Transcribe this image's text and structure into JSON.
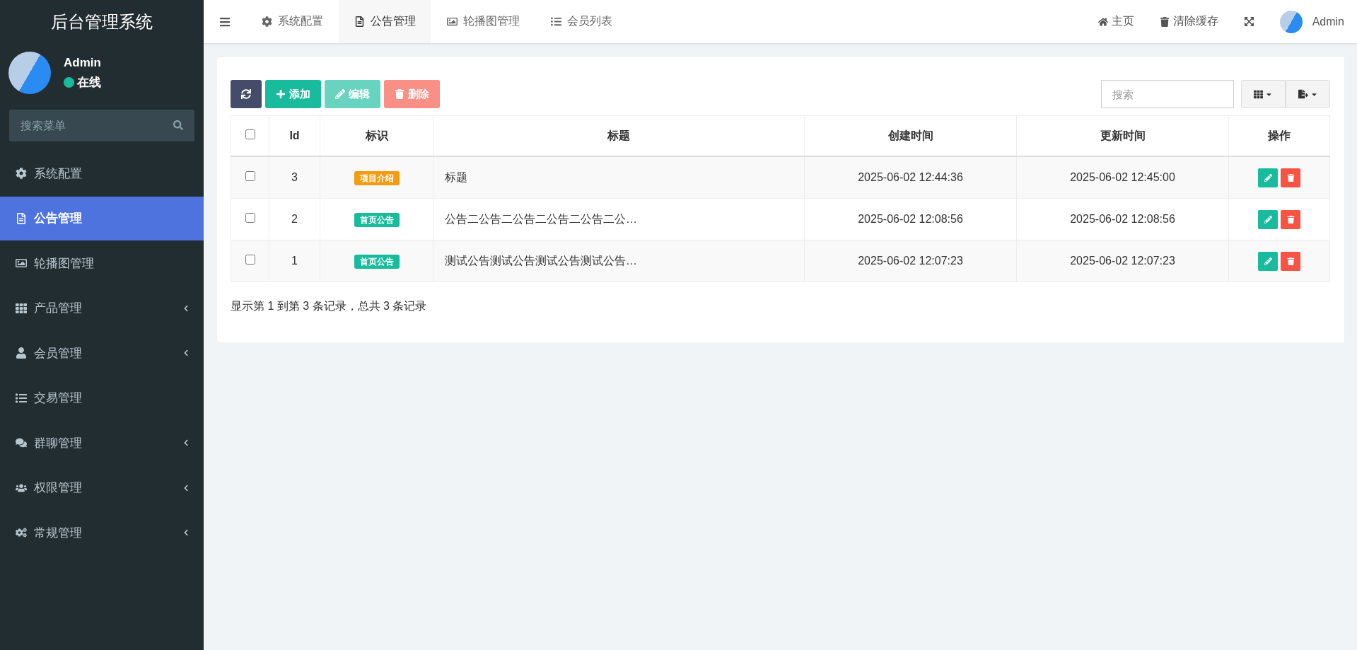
{
  "sidebar": {
    "title": "后台管理系统",
    "user": {
      "name": "Admin",
      "status": "在线"
    },
    "search": {
      "placeholder": "搜索菜单"
    },
    "items": [
      {
        "label": "系统配置",
        "selected": false,
        "expandable": false
      },
      {
        "label": "公告管理",
        "selected": true,
        "expandable": false
      },
      {
        "label": "轮播图管理",
        "selected": false,
        "expandable": false
      },
      {
        "label": "产品管理",
        "selected": false,
        "expandable": true
      },
      {
        "label": "会员管理",
        "selected": false,
        "expandable": true
      },
      {
        "label": "交易管理",
        "selected": false,
        "expandable": false
      },
      {
        "label": "群聊管理",
        "selected": false,
        "expandable": true
      },
      {
        "label": "权限管理",
        "selected": false,
        "expandable": true
      },
      {
        "label": "常规管理",
        "selected": false,
        "expandable": true
      }
    ]
  },
  "topbar": {
    "tabs": [
      {
        "label": "系统配置",
        "selected": false
      },
      {
        "label": "公告管理",
        "selected": true
      },
      {
        "label": "轮播图管理",
        "selected": false
      },
      {
        "label": "会员列表",
        "selected": false
      }
    ],
    "links": [
      "主页",
      "清除缓存"
    ],
    "user": "Admin"
  },
  "toolbar": {
    "buttons": [
      {
        "kind": "refresh",
        "disabled": false
      },
      {
        "kind": "add",
        "label": "添加",
        "disabled": false
      },
      {
        "kind": "edit",
        "label": "编辑",
        "disabled": true
      },
      {
        "kind": "delete",
        "label": "删除",
        "disabled": true
      }
    ],
    "search": {
      "placeholder": "搜索"
    }
  },
  "table": {
    "columns": [
      "Id",
      "标识",
      "标题",
      "创建时间",
      "更新时间",
      "操作"
    ],
    "header_checked": false,
    "rows": [
      {
        "checked": false,
        "id": "3",
        "tag": {
          "label": "项目介绍",
          "color": "#f39c12"
        },
        "title": "标题",
        "created": "2025-06-02 12:44:36",
        "updated": "2025-06-02 12:45:00"
      },
      {
        "checked": false,
        "id": "2",
        "tag": {
          "label": "首页公告",
          "color": "#18bc9c"
        },
        "title": "公告二公告二公告二公告二公告二公…",
        "created": "2025-06-02 12:08:56",
        "updated": "2025-06-02 12:08:56"
      },
      {
        "checked": false,
        "id": "1",
        "tag": {
          "label": "首页公告",
          "color": "#18bc9c"
        },
        "title": "测试公告测试公告测试公告测试公告…",
        "created": "2025-06-02 12:07:23",
        "updated": "2025-06-02 12:07:23"
      }
    ]
  },
  "pagination": "显示第 1 到第 3 条记录，总共 3 条记录"
}
